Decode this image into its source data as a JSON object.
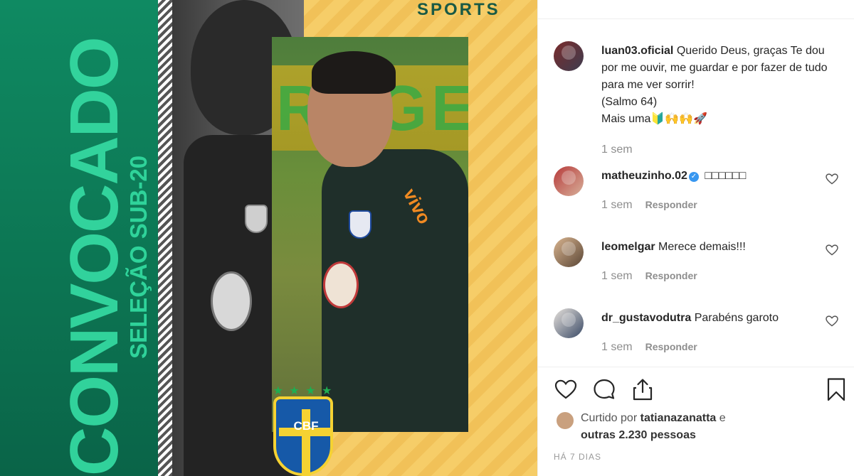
{
  "image": {
    "headline": "CONVOCADO",
    "subheadline": "SELEÇÃO SUB-20",
    "brand": "SPORTS",
    "crest_text": "CBF",
    "crest_stars": "★ ★ ★ ★ ★",
    "backdrop_letters": "RAGE",
    "sponsor": "vivo"
  },
  "post": {
    "caption": {
      "username": "luan03.oficial",
      "lines": [
        "Querido Deus, graças Te dou por me ouvir, me guardar e por fazer de tudo para me ver sorrir!",
        "(Salmo 64)",
        "Mais uma🔰🙌🙌🚀"
      ],
      "time": "1 sem"
    },
    "comments": [
      {
        "username": "matheuzinho.02",
        "verified": true,
        "text": "□□□□□□",
        "time": "1 sem",
        "reply": "Responder"
      },
      {
        "username": "leomelgar",
        "verified": false,
        "text": "Merece demais!!!",
        "time": "1 sem",
        "reply": "Responder"
      },
      {
        "username": "dr_gustavodutra",
        "verified": false,
        "text": "Parabéns garoto",
        "time": "1 sem",
        "reply": "Responder"
      }
    ],
    "likes": {
      "prefix": "Curtido por",
      "user": "tatianazanatta",
      "suffix": "e",
      "others": "outras 2.230 pessoas"
    },
    "posted": "HÁ 7 DIAS"
  },
  "icons": {
    "like": "heart-icon",
    "comment": "comment-icon",
    "share": "share-icon",
    "save": "bookmark-icon"
  },
  "colors": {
    "green": "#0f8a62",
    "accent_green": "#34d8a0",
    "yellow": "#f6cd68",
    "verified_blue": "#3897f0",
    "meta_gray": "#8e8e8e"
  }
}
